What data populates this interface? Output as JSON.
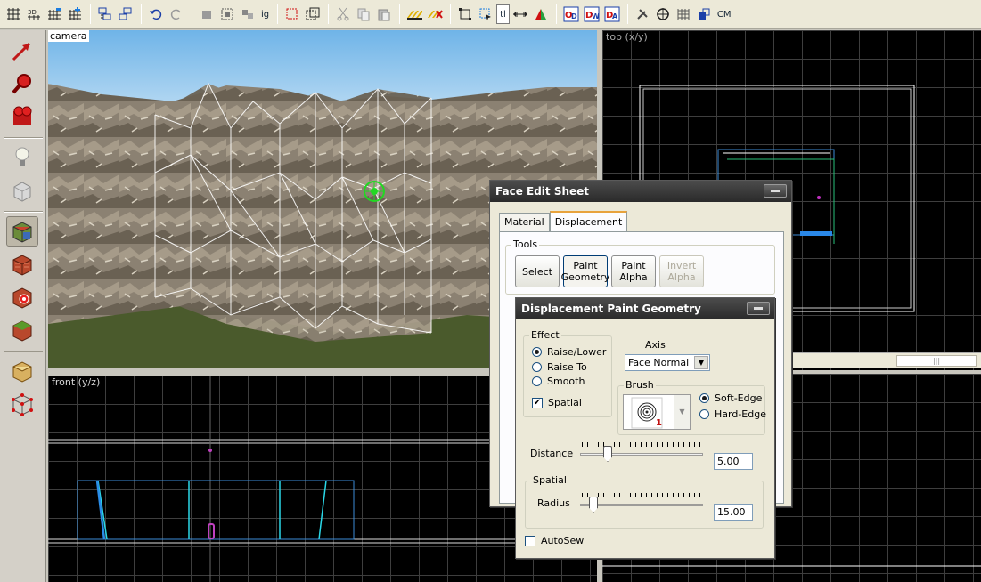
{
  "toolbar": {
    "icons": [
      "grid-icon",
      "grid-3d-icon",
      "grid-smaller-icon",
      "grid-larger-icon",
      "group-icon",
      "ungroup-icon",
      "undo-icon",
      "redo-icon",
      "carve-icon",
      "hide-icon",
      "show-icon",
      "ignore-groups-icon",
      "select-icon",
      "selection-box-icon",
      "cut-icon",
      "copy-icon",
      "paste-icon",
      "texture-lock-icon",
      "texture-scale-lock-icon",
      "toolbar-box-icon",
      "select-face-icon",
      "tl-icon",
      "center-icon",
      "flip-icon",
      "displacement-od-icon",
      "displacement-dw-icon",
      "displacement-da-icon",
      "tools-icon",
      "cordon-icon",
      "cordon-toggle-icon",
      "radius-culling-icon",
      "cm-icon"
    ],
    "labels": {
      "ig": "ig",
      "tl": "tl",
      "cm": "CM"
    }
  },
  "lefttools": [
    "selection-tool-icon",
    "magnify-tool-icon",
    "camera-tool-icon",
    "entity-tool-icon",
    "block-tool-icon",
    "texture-application-icon",
    "apply-current-texture-icon",
    "decal-tool-icon",
    "overlay-tool-icon",
    "clipping-tool-icon",
    "vertex-tool-icon"
  ],
  "viewports": {
    "camera": "camera",
    "top": "top (x/y)",
    "front": "front (y/z)"
  },
  "face_edit": {
    "title": "Face Edit Sheet",
    "tabs": [
      "Material",
      "Displacement"
    ],
    "tools_group": "Tools",
    "buttons": {
      "select": "Select",
      "paint_geometry": "Paint Geometry",
      "paint_alpha": "Paint Alpha",
      "invert_alpha": "Invert Alpha"
    }
  },
  "paint_geometry": {
    "title": "Displacement Paint Geometry",
    "effect_group": "Effect",
    "effects": [
      {
        "label": "Raise/Lower",
        "checked": true
      },
      {
        "label": "Raise To",
        "checked": false
      },
      {
        "label": "Smooth",
        "checked": false
      }
    ],
    "spatial_label": "Spatial",
    "spatial_checked": true,
    "axis_label": "Axis",
    "axis_value": "Face Normal",
    "brush_group": "Brush",
    "brush_number": "1",
    "brush_options": [
      {
        "label": "Soft-Edge",
        "checked": true
      },
      {
        "label": "Hard-Edge",
        "checked": false
      }
    ],
    "distance_label": "Distance",
    "distance_value": "5.00",
    "distance_fraction": 0.2,
    "spatial_group": "Spatial",
    "radius_label": "Radius",
    "radius_value": "15.00",
    "radius_fraction": 0.08,
    "autosew_label": "AutoSew",
    "autosew_checked": false
  }
}
